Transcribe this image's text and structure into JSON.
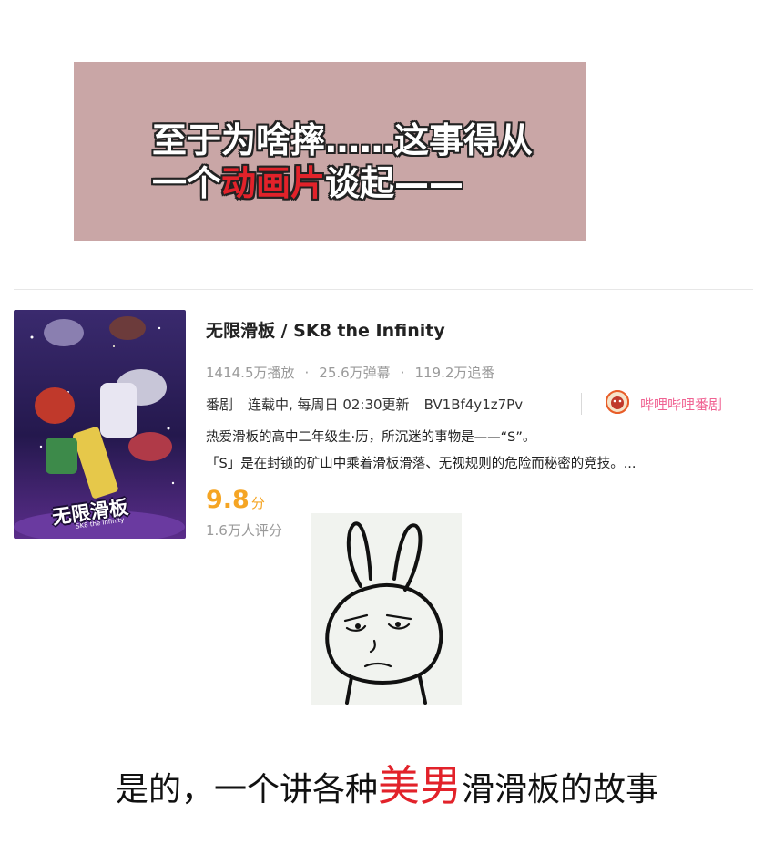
{
  "banner": {
    "line1": "至于为啥摔……这事得从",
    "line2_pre": "一个",
    "line2_highlight": "动画片",
    "line2_post": "谈起——",
    "background_color": "#c9a6a6",
    "highlight_color": "#e2222a"
  },
  "anime": {
    "title": "无限滑板 / SK8 the Infinity",
    "poster_title": "无限滑板",
    "poster_subtitle": "SK8 the Infinity",
    "plays": "1414.5万播放",
    "danmaku": "25.6万弹幕",
    "follows": "119.2万追番",
    "stats_sep": "·",
    "type": "番剧",
    "schedule": "连载中, 每周日 02:30更新",
    "bvid": "BV1Bf4y1z7Pv",
    "channel": "哔哩哔哩番剧",
    "desc1": "热爱滑板的高中二年级生·历，所沉迷的事物是——“S”。",
    "desc2": "「S」是在封锁的矿山中乘着滑板滑落、无视规则的危险而秘密的竞技。...",
    "score": "9.8",
    "score_unit": "分",
    "raters": "1.6万人评分",
    "score_color": "#f5a524",
    "channel_color": "#f06292"
  },
  "caption": {
    "pre": "是的，一个讲各种",
    "highlight": "美男",
    "post": "滑滑板的故事",
    "highlight_color": "#e2222a"
  }
}
